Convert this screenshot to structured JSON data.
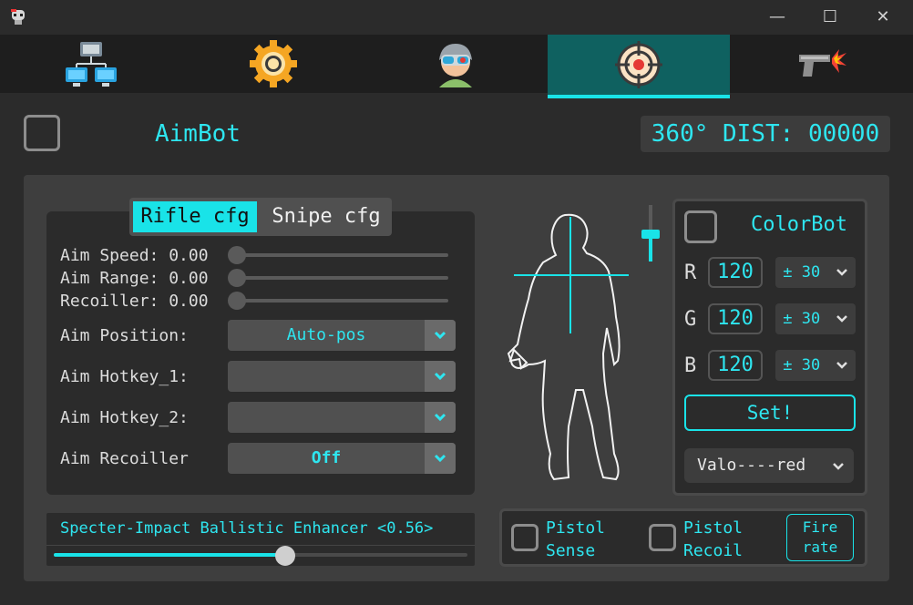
{
  "window": {
    "minimize_glyph": "—",
    "maximize_glyph": "☐",
    "close_glyph": "✕"
  },
  "tabs": [
    {
      "name": "network-icon"
    },
    {
      "name": "gear-icon"
    },
    {
      "name": "soldier-icon"
    },
    {
      "name": "crosshair-icon",
      "active": true
    },
    {
      "name": "pistol-icon"
    }
  ],
  "header": {
    "title": "AimBot",
    "distance_label": "360° DIST: 00000"
  },
  "config_tabs": {
    "rifle": "Rifle cfg",
    "snipe": "Snipe cfg"
  },
  "sliders": {
    "aim_speed": {
      "label": "Aim Speed: 0.00",
      "value": 0
    },
    "aim_range": {
      "label": "Aim Range: 0.00",
      "value": 0
    },
    "recoiller": {
      "label": "Recoiller: 0.00",
      "value": 0
    }
  },
  "settings": {
    "aim_position": {
      "label": "Aim Position:",
      "value": "Auto-pos"
    },
    "aim_hotkey_1": {
      "label": "Aim Hotkey_1:",
      "value": ""
    },
    "aim_hotkey_2": {
      "label": "Aim Hotkey_2:",
      "value": ""
    },
    "aim_recoiller": {
      "label": "Aim Recoiller",
      "value": "Off"
    }
  },
  "enhancer": {
    "label": "Specter-Impact Ballistic Enhancer <0.56>",
    "value": 0.56
  },
  "colorbot": {
    "title": "ColorBot",
    "channels": [
      {
        "label": "R",
        "value": "120",
        "tolerance": "± 30"
      },
      {
        "label": "G",
        "value": "120",
        "tolerance": "± 30"
      },
      {
        "label": "B",
        "value": "120",
        "tolerance": "± 30"
      }
    ],
    "set_label": "Set!",
    "preset": "Valo----red"
  },
  "pistol": {
    "sense_label_1": "Pistol",
    "sense_label_2": "Sense",
    "recoil_label_1": "Pistol",
    "recoil_label_2": "Recoil",
    "fire_label_1": "Fire",
    "fire_label_2": "rate"
  },
  "colors": {
    "accent": "#2ee6f0",
    "active_tab": "#0f6160",
    "background": "#2b2b2b",
    "panel": "#3e3e3e"
  }
}
